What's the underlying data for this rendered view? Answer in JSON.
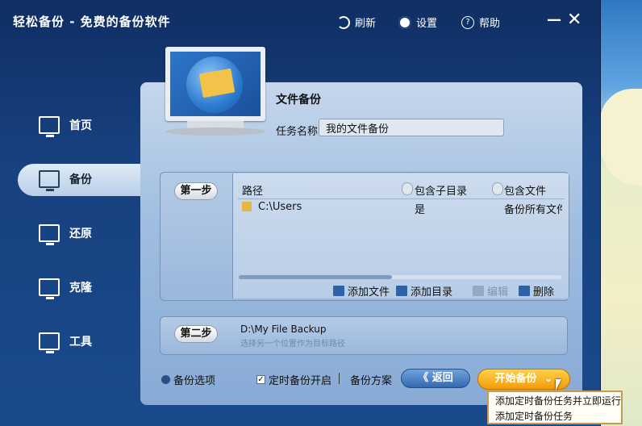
{
  "window": {
    "title": "轻松备份 - 免费的备份软件"
  },
  "titlebar": {
    "refresh_label": "刷新",
    "settings_label": "设置",
    "help_label": "帮助",
    "minimize_glyph": "—",
    "close_glyph": "✕"
  },
  "sidebar": {
    "items": [
      {
        "label": "首页",
        "icon": "home-icon"
      },
      {
        "label": "备份",
        "icon": "backup-icon",
        "active": true
      },
      {
        "label": "还原",
        "icon": "restore-icon"
      },
      {
        "label": "克隆",
        "icon": "clone-icon"
      },
      {
        "label": "工具",
        "icon": "tools-icon"
      }
    ]
  },
  "main": {
    "section_title": "文件备份",
    "task_name_label": "任务名称",
    "task_name_value": "我的文件备份",
    "step1": {
      "button_label": "第一步",
      "columns": [
        "路径",
        "包含子目录",
        "包含文件"
      ],
      "rows": [
        {
          "path": "C:\\Users",
          "subdirs": "是",
          "files": "备份所有文件"
        }
      ],
      "actions": {
        "add_file": "添加文件",
        "add_dir": "添加目录",
        "edit": "编辑",
        "delete": "删除"
      }
    },
    "step2": {
      "button_label": "第二步",
      "destination": "D:\\My File Backup",
      "hint": "选择另一个位置作为目标路径"
    }
  },
  "footer": {
    "backup_options": "备份选项",
    "scheduled_checked": true,
    "scheduled_label": "定时备份开启",
    "scheme_label": "备份方案",
    "back_label": "《 返回",
    "start_label": "开始备份"
  },
  "dropdown": {
    "items": [
      "添加定时备份任务并立即运行",
      "添加定时备份任务"
    ]
  },
  "colors": {
    "accent": "#f39b0a",
    "window_bg": "#17407e",
    "panel_bg": "#9fbde0"
  }
}
